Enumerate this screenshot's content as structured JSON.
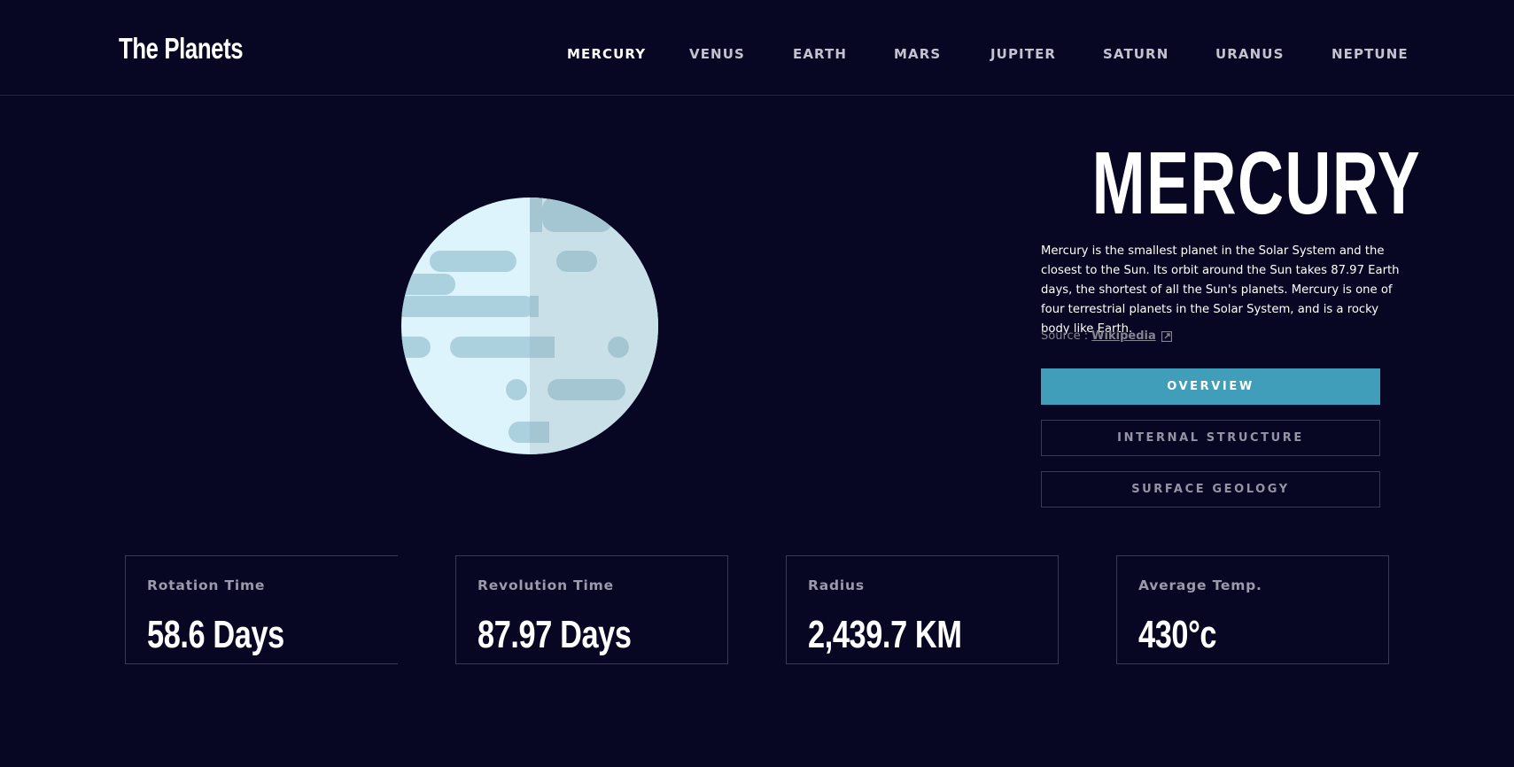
{
  "header": {
    "logo": "The Planets",
    "nav": [
      {
        "label": "MERCURY",
        "active": true
      },
      {
        "label": "VENUS",
        "active": false
      },
      {
        "label": "EARTH",
        "active": false
      },
      {
        "label": "MARS",
        "active": false
      },
      {
        "label": "JUPITER",
        "active": false
      },
      {
        "label": "SATURN",
        "active": false
      },
      {
        "label": "URANUS",
        "active": false
      },
      {
        "label": "NEPTUNE",
        "active": false
      }
    ]
  },
  "planet": {
    "name": "MERCURY",
    "description": "Mercury is the smallest planet in the Solar System and the closest to the Sun. Its orbit around the Sun takes 87.97 Earth days, the shortest of all the Sun's planets. Mercury is one of four terrestrial planets in the Solar System, and is a rocky body like Earth.",
    "source_prefix": "Source : ",
    "source_link": "Wikipedia",
    "icon": "planet-mercury-icon",
    "colors": {
      "light": "#def4fc",
      "shade": "#c9e0e8",
      "crater": "#abd1de",
      "crater_shade": "#a3c6d2"
    }
  },
  "tabs": [
    {
      "label": "OVERVIEW",
      "active": true
    },
    {
      "label": "INTERNAL STRUCTURE",
      "active": false
    },
    {
      "label": "SURFACE GEOLOGY",
      "active": false
    }
  ],
  "stats": [
    {
      "label": "Rotation Time",
      "value": "58.6 Days"
    },
    {
      "label": "Revolution Time",
      "value": "87.97 Days"
    },
    {
      "label": "Radius",
      "value": "2,439.7 KM"
    },
    {
      "label": "Average Temp.",
      "value": "430°c"
    }
  ],
  "theme": {
    "background": "#070724",
    "accent": "#419ebb",
    "border": "#3a3a52",
    "muted_text": "#838391"
  }
}
